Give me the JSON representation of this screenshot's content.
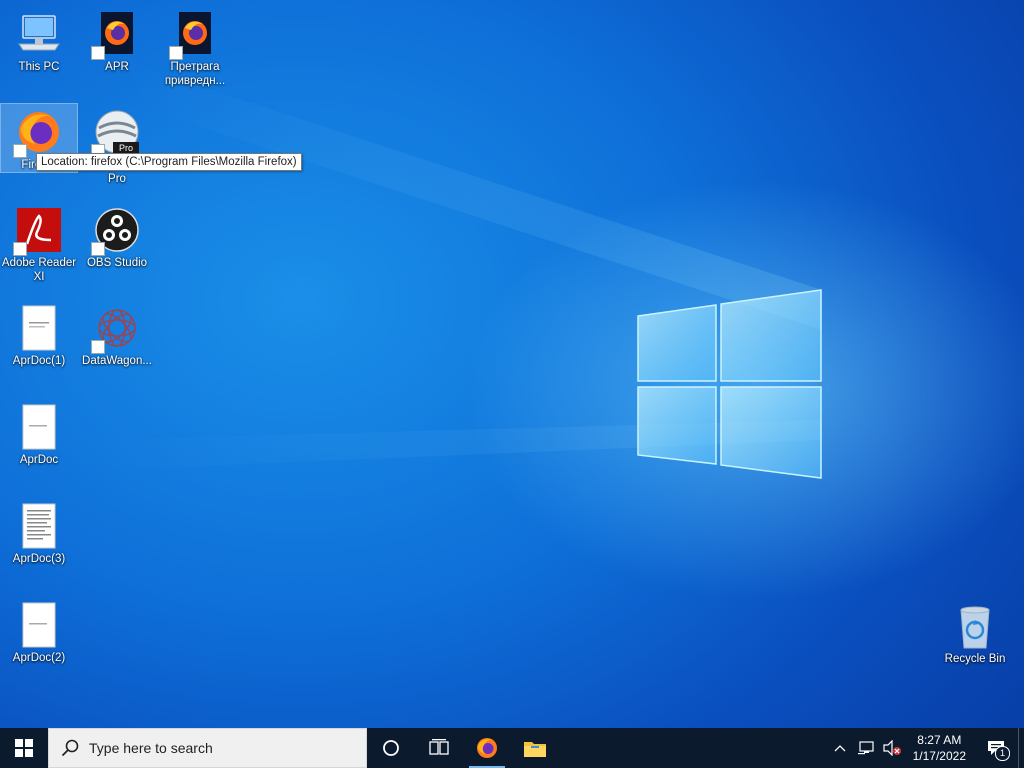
{
  "desktop": {
    "icons": [
      {
        "label": "This PC",
        "icon": "this-pc-icon"
      },
      {
        "label": "APR",
        "icon": "firefox-icon"
      },
      {
        "label": "Претрага привредн...",
        "icon": "firefox-icon"
      },
      {
        "label": "Firefox",
        "icon": "firefox-icon"
      },
      {
        "label": "Pro",
        "icon": "google-earth-pro-icon",
        "badge": "Pro"
      },
      {
        "label": "Adobe Reader XI",
        "icon": "adobe-reader-icon"
      },
      {
        "label": "OBS Studio",
        "icon": "obs-studio-icon"
      },
      {
        "label": "AprDoc(1)",
        "icon": "document-icon"
      },
      {
        "label": "DataWagon...",
        "icon": "datawagon-icon"
      },
      {
        "label": "AprDoc",
        "icon": "document-icon"
      },
      {
        "label": "AprDoc(3)",
        "icon": "document-icon"
      },
      {
        "label": "AprDoc(2)",
        "icon": "document-icon"
      },
      {
        "label": "Recycle Bin",
        "icon": "recycle-bin-icon"
      }
    ],
    "tooltip": "Location: firefox (C:\\Program Files\\Mozilla Firefox)"
  },
  "taskbar": {
    "search_placeholder": "Type here to search",
    "pinned": [
      "start-icon",
      "cortana-icon",
      "task-view-icon",
      "firefox-icon",
      "file-explorer-icon"
    ],
    "clock": {
      "time": "8:27 AM",
      "date": "1/17/2022"
    },
    "notification_count": "1"
  },
  "colors": {
    "taskbar_bg": "#0c1a2e",
    "desktop_accent": "#0e6fd8",
    "logo_glow": "#7fd8ff"
  }
}
